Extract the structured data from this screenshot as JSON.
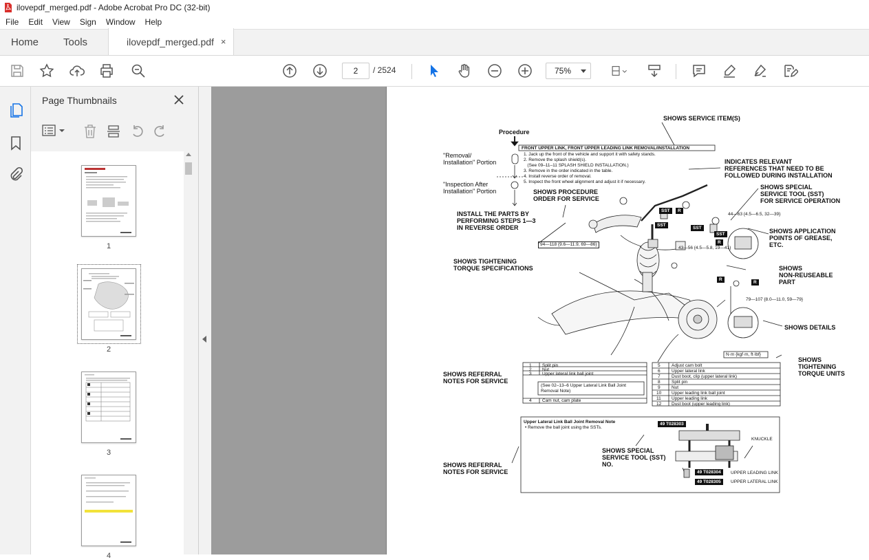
{
  "window": {
    "title": "ilovepdf_merged.pdf - Adobe Acrobat Pro DC (32-bit)"
  },
  "menu": [
    "File",
    "Edit",
    "View",
    "Sign",
    "Window",
    "Help"
  ],
  "tabs": {
    "home": "Home",
    "tools": "Tools",
    "document": "ilovepdf_merged.pdf",
    "close_glyph": "×"
  },
  "toolbar": {
    "current_page": "2",
    "total_pages": "/ 2524",
    "zoom": "75%"
  },
  "sidebar": {
    "title": "Page Thumbnails",
    "thumbnails": [
      {
        "label": "1"
      },
      {
        "label": "2"
      },
      {
        "label": "3"
      },
      {
        "label": "4"
      }
    ]
  },
  "colors": {
    "accent": "#1473e6",
    "gray_bg": "#9c9c9c",
    "panel_bg": "#f2f2f2"
  },
  "doc": {
    "procedure": "Procedure",
    "section_title": "FRONT UPPER LINK, FRONT UPPER LEADING LINK REMOVAL/INSTALLATION",
    "removal_portion": "\"Removal/\nInstallation\" Portion",
    "inspection_portion": "\"Inspection After\nInstallation\" Portion",
    "steps": [
      "1. Jack up the front of the vehicle and support it with safety stands.",
      "2. Remove the splash shield(s).",
      "   (See 09–11–11 SPLASH SHIELD INSTALLATION.)",
      "3. Remove in the order indicated in the table.",
      "4. Install reverse order of removal.",
      "5. Inspect the front wheel alignment and adjust it if necessary."
    ],
    "shows_service_items": "SHOWS SERVICE ITEM(S)",
    "indicates_relevant": "INDICATES RELEVANT\nREFERENCES THAT NEED TO BE\nFOLLOWED DURING INSTALLATION",
    "shows_procedure_order": "SHOWS PROCEDURE\nORDER FOR SERVICE",
    "shows_sst": "SHOWS SPECIAL\nSERVICE TOOL (SST)\nFOR SERVICE OPERATION",
    "install_parts": "INSTALL THE PARTS BY\nPERFORMING STEPS 1—3\nIN REVERSE ORDER",
    "shows_grease": "SHOWS APPLICATION\nPOINTS OF GREASE,\nETC.",
    "shows_torque_specs": "SHOWS TIGHTENING\nTORQUE SPECIFICATIONS",
    "shows_nonreuse": "SHOWS\nNON-REUSEABLE\nPART",
    "shows_details": "SHOWS DETAILS",
    "torque_units_box": "N·m {kgf·m, ft·lbf}",
    "shows_torque_units": "SHOWS\nTIGHTENING\nTORQUE UNITS",
    "shows_referral_1": "SHOWS REFERRAL\nNOTES FOR SERVICE",
    "shows_referral_2": "SHOWS REFERRAL\nNOTES FOR SERVICE",
    "shows_sst_no": "SHOWS SPECIAL\nSERVICE TOOL (SST)\nNO.",
    "torque_a": "94—118 {9.6—11.9, 69—86}",
    "torque_b": "44—63 {4.5—6.5, 32—39}",
    "torque_c": "43—56 {4.5—5.8, 19—41}",
    "torque_d": "79—107 {8.0—11.0, 59—79}",
    "sst_tag": "SST",
    "r_tag": "R",
    "table_left": [
      {
        "no": "1",
        "item": "Split pin"
      },
      {
        "no": "2",
        "item": "Nut"
      },
      {
        "no": "3",
        "item": "Upper lateral link ball joint"
      },
      {
        "no": "4",
        "item": "Cam nut, cam plate"
      }
    ],
    "table_left_note": "(See 02–13–6 Upper Lateral Link Ball Joint Removal Note)",
    "table_right": [
      {
        "no": "5",
        "item": "Adjust cam bolt"
      },
      {
        "no": "6",
        "item": "Upper lateral link"
      },
      {
        "no": "7",
        "item": "Dust boot, clip (upper lateral link)"
      },
      {
        "no": "8",
        "item": "Split pin"
      },
      {
        "no": "9",
        "item": "Nut"
      },
      {
        "no": "10",
        "item": "Upper leading link ball joint"
      },
      {
        "no": "11",
        "item": "Upper leading link"
      },
      {
        "no": "12",
        "item": "Dust boot (upper leading link)"
      }
    ],
    "note_title": "Upper Lateral Link Ball Joint Removal Note",
    "note_bullet": "• Remove the ball joint using the SSTs.",
    "sst_numbers": [
      "49 T028303",
      "49 T028304",
      "49 T028305"
    ],
    "knuckle": "KNUCKLE",
    "upper_leading_link": "UPPER LEADING LINK",
    "upper_lateral_link": "UPPER LATERAL LINK"
  }
}
